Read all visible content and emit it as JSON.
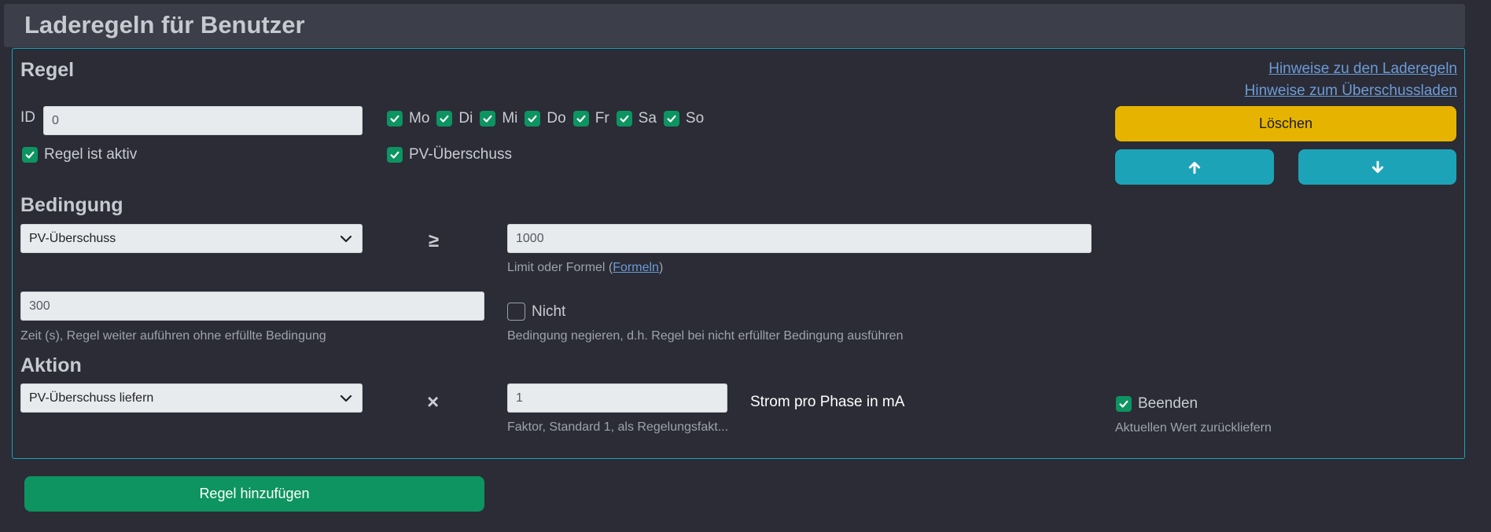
{
  "header": {
    "title": "Laderegeln für Benutzer"
  },
  "rule": {
    "section_title": "Regel",
    "links": {
      "rules_help": "Hinweise zu den Laderegeln",
      "surplus_help": "Hinweise zum Überschussladen"
    },
    "id_label": "ID",
    "id_value": "0",
    "days": [
      {
        "label": "Mo",
        "checked": true
      },
      {
        "label": "Di",
        "checked": true
      },
      {
        "label": "Mi",
        "checked": true
      },
      {
        "label": "Do",
        "checked": true
      },
      {
        "label": "Fr",
        "checked": true
      },
      {
        "label": "Sa",
        "checked": true
      },
      {
        "label": "So",
        "checked": true
      }
    ],
    "active_label": "Regel ist aktiv",
    "active_checked": true,
    "pv_label": "PV-Überschuss",
    "pv_checked": true,
    "delete_button": "Löschen",
    "up_icon": "arrow-up-icon",
    "down_icon": "arrow-down-icon"
  },
  "condition": {
    "section_title": "Bedingung",
    "source_selected": "PV-Überschuss",
    "operator": "≥",
    "limit_value": "1000",
    "limit_help_prefix": "Limit oder Formel (",
    "limit_help_link": "Formeln",
    "limit_help_suffix": ")",
    "time_value": "300",
    "time_help": "Zeit (s), Regel weiter auführen ohne erfüllte Bedingung",
    "negate_label": "Nicht",
    "negate_checked": false,
    "negate_help": "Bedingung negieren, d.h. Regel bei nicht erfüllter Bedingung ausführen"
  },
  "action": {
    "section_title": "Aktion",
    "action_selected": "PV-Überschuss liefern",
    "operator": "×",
    "factor_value": "1",
    "factor_help": "Faktor, Standard 1, als Regelungsfakt...",
    "unit_label": "Strom pro Phase in mA",
    "finish_label": "Beenden",
    "finish_checked": true,
    "finish_help": "Aktuellen Wert zurückliefern"
  },
  "footer": {
    "add_button": "Regel hinzufügen"
  },
  "colors": {
    "background": "#2b2c36",
    "accent_green": "#0d9460",
    "accent_cyan": "#1ca3b8",
    "accent_yellow": "#e6b400"
  }
}
